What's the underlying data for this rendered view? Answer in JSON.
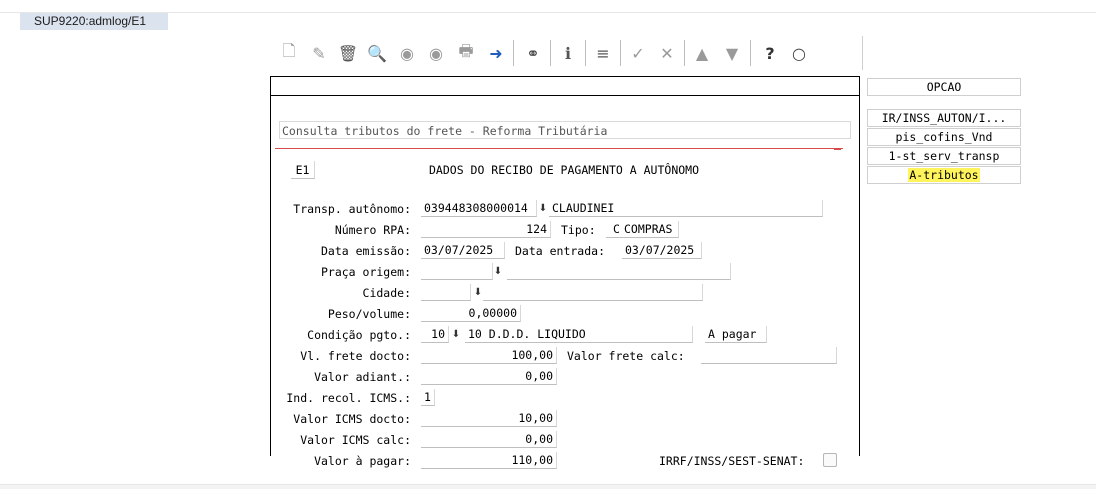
{
  "window": {
    "title": "SUP9220:admlog/E1"
  },
  "toolbar": {
    "icons": [
      "new-icon",
      "edit-icon",
      "trash-icon",
      "search-icon",
      "prev-icon",
      "next-icon",
      "print-icon",
      "export-icon",
      "binoculars-icon",
      "info-icon",
      "bar-icon",
      "check-icon",
      "tools-icon",
      "up-icon",
      "down-icon",
      "help-icon",
      "comment-icon"
    ]
  },
  "screen": {
    "title": "Consulta tributos do frete - Reforma Tributária",
    "code": "E1",
    "heading": "DADOS DO RECIBO DE PAGAMENTO A AUTÔNOMO"
  },
  "form": {
    "transp_label": "Transp. autônomo:",
    "transp_code": "039448308000014",
    "transp_name": "CLAUDINEI",
    "rpa_label": "Número RPA:",
    "rpa_value": "124",
    "tipo_label": "Tipo:",
    "tipo_value": "C",
    "tipo_desc": "COMPRAS",
    "emissao_label": "Data emissão:",
    "emissao_value": "03/07/2025",
    "entrada_label": "Data entrada:",
    "entrada_value": "03/07/2025",
    "praca_label": "Praça origem:",
    "praca_value": "",
    "praca_desc": "",
    "cidade_label": "Cidade:",
    "cidade_value": "",
    "cidade_desc": "",
    "peso_label": "Peso/volume:",
    "peso_value": "0,00000",
    "cond_label": "Condição pgto.:",
    "cond_code": "10",
    "cond_desc": "10 D.D.D. LIQUIDO",
    "cond_status": "A pagar",
    "vl_frete_label": "Vl. frete docto:",
    "vl_frete_value": "100,00",
    "vl_frete_calc_label": "Valor frete calc:",
    "vl_frete_calc_value": "",
    "adiant_label": "Valor adiant.:",
    "adiant_value": "0,00",
    "ind_icms_label": "Ind. recol. ICMS.:",
    "ind_icms_value": "1",
    "icms_docto_label": "Valor ICMS docto:",
    "icms_docto_value": "10,00",
    "icms_calc_label": "Valor ICMS calc:",
    "icms_calc_value": "0,00",
    "pagar_label": "Valor à pagar:",
    "pagar_value": "110,00",
    "irrf_label": "IRRF/INSS/SEST-SENAT:"
  },
  "side_menu": {
    "header": "OPCAO",
    "items": [
      "IR/INSS_AUTON/I...",
      "pis_cofins_Vnd",
      "1-st_serv_transp",
      "A-tributos"
    ],
    "highlight_color": "#fff45c"
  }
}
